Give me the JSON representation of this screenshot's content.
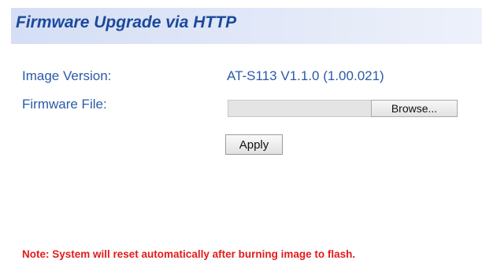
{
  "header": {
    "title": "Firmware Upgrade via HTTP"
  },
  "form": {
    "image_version_label": "Image Version:",
    "image_version_value": "AT-S113 V1.1.0 (1.00.021)",
    "firmware_file_label": "Firmware File:",
    "firmware_file_value": "",
    "browse_label": "Browse...",
    "apply_label": "Apply"
  },
  "footer": {
    "note": "Note: System will reset automatically after burning image to flash."
  },
  "colors": {
    "title": "#1b4a9a",
    "label": "#2a5aa6",
    "note": "#e31b1b",
    "header_bg": "#d5def5"
  }
}
